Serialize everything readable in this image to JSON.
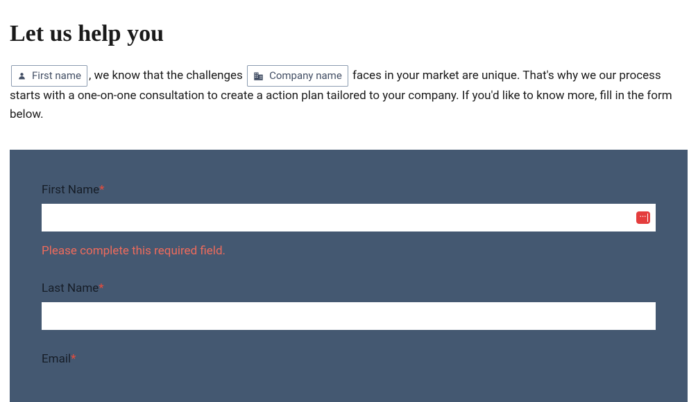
{
  "heading": "Let us help you",
  "intro": {
    "text_before_token1": "",
    "token_first_name": "First name",
    "text_between_tokens": ", we know that the challenges ",
    "token_company_name": "Company name",
    "text_after_tokens": " faces in your market are unique. That's why we our process starts with a one-on-one consultation to create a action plan tailored to your company. If you'd like to know more, fill in the form below."
  },
  "form": {
    "first_name": {
      "label": "First Name",
      "value": "",
      "required": "*",
      "error": "Please complete this required field."
    },
    "last_name": {
      "label": "Last Name",
      "value": "",
      "required": "*"
    },
    "email": {
      "label": "Email",
      "required": "*"
    }
  },
  "colors": {
    "panel_bg": "#445871",
    "error_text": "#ef6b5c",
    "required": "#e74c3c",
    "token_border": "#8b9bb0",
    "badge_bg": "#e43d3d"
  }
}
